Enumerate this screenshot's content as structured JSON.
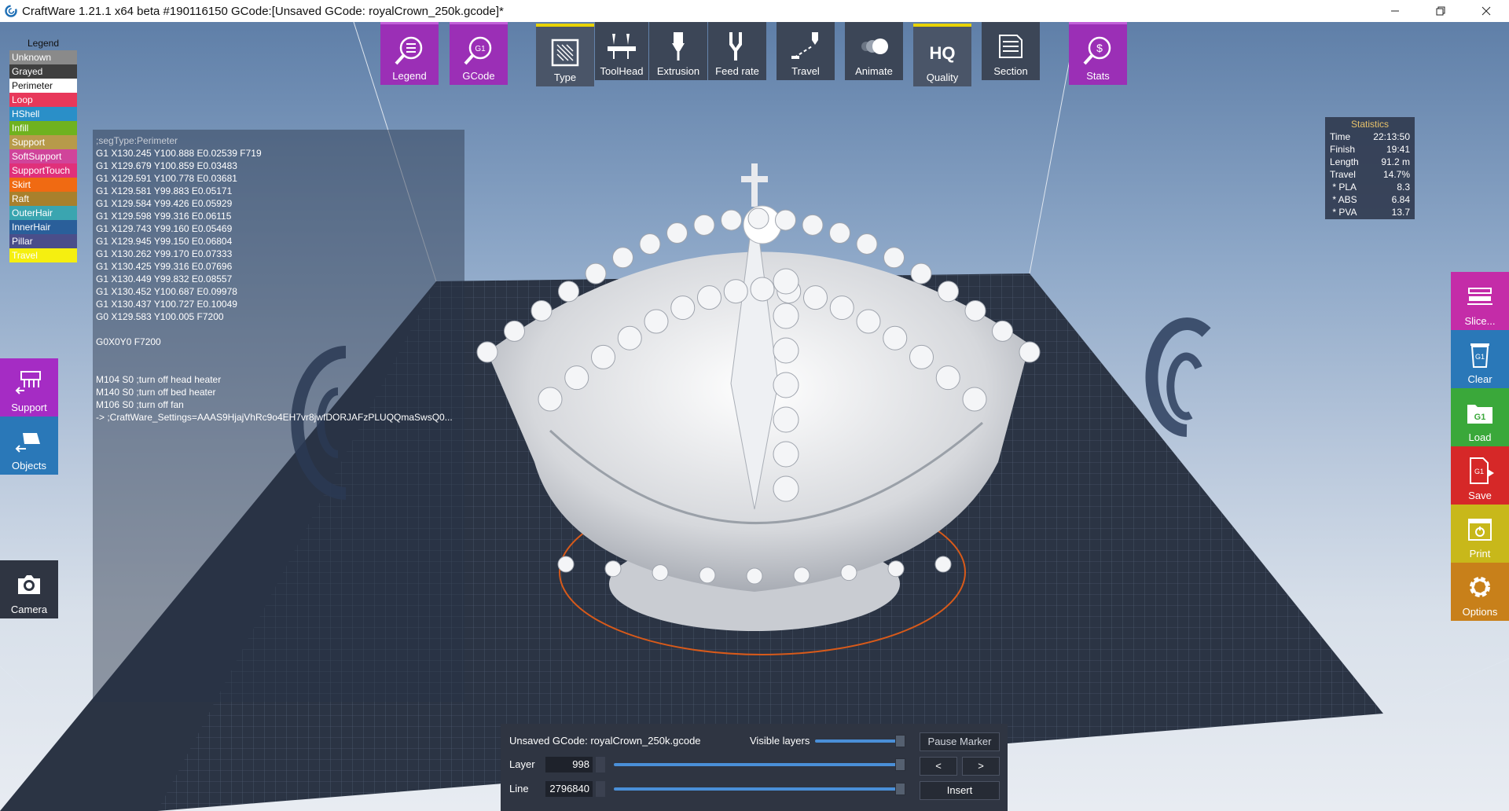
{
  "window": {
    "title": "CraftWare 1.21.1 x64 beta #190116150   GCode:[Unsaved GCode: royalCrown_250k.gcode]*"
  },
  "legend": {
    "title": "Legend",
    "items": [
      {
        "label": "Unknown",
        "color": "#8a8a8a",
        "text": "#ffffff"
      },
      {
        "label": "Grayed",
        "color": "#3f3f3f",
        "text": "#ffffff"
      },
      {
        "label": "Perimeter",
        "color": "#ffffff",
        "text": "#111111"
      },
      {
        "label": "Loop",
        "color": "#e8385a",
        "text": "#ffffff"
      },
      {
        "label": "HShell",
        "color": "#2a8fc8",
        "text": "#ffffff"
      },
      {
        "label": "Infill",
        "color": "#6fb21f",
        "text": "#ffffff"
      },
      {
        "label": "Support",
        "color": "#b79a4a",
        "text": "#ffffff"
      },
      {
        "label": "SoftSupport",
        "color": "#d0449a",
        "text": "#ffffff"
      },
      {
        "label": "SupportTouch",
        "color": "#e0307a",
        "text": "#ffffff"
      },
      {
        "label": "Skirt",
        "color": "#f06a12",
        "text": "#ffffff"
      },
      {
        "label": "Raft",
        "color": "#a8802c",
        "text": "#ffffff"
      },
      {
        "label": "OuterHair",
        "color": "#3aa5b0",
        "text": "#ffffff"
      },
      {
        "label": "InnerHair",
        "color": "#2a5f9a",
        "text": "#ffffff"
      },
      {
        "label": "Pillar",
        "color": "#4a4e8a",
        "text": "#ffffff"
      },
      {
        "label": "Travel",
        "color": "#f5ef10",
        "text": "#ffffff"
      }
    ]
  },
  "gcode": {
    "lines": [
      ";segType:Perimeter",
      "G1 X130.245 Y100.888 E0.02539 F719",
      "G1 X129.679 Y100.859 E0.03483",
      "G1 X129.591 Y100.778 E0.03681",
      "G1 X129.581 Y99.883 E0.05171",
      "G1 X129.584 Y99.426 E0.05929",
      "G1 X129.598 Y99.316 E0.06115",
      "G1 X129.743 Y99.160 E0.05469",
      "G1 X129.945 Y99.150 E0.06804",
      "G1 X130.262 Y99.170 E0.07333",
      "G1 X130.425 Y99.316 E0.07696",
      "G1 X130.449 Y99.832 E0.08557",
      "G1 X130.452 Y100.687 E0.09978",
      "G1 X130.437 Y100.727 E0.10049",
      "G0 X129.583 Y100.005 F7200",
      "",
      "G0X0Y0 F7200",
      "",
      "",
      "M104 S0 ;turn off head heater",
      "M140 S0 ;turn off bed heater",
      "M106 S0 ;turn off fan",
      "-> ;CraftWare_Settings=AAAS9HjajVhRc9o4EH7vr8jwfDORJAFzPLUQQmaSwsQ0..."
    ]
  },
  "toolbar": {
    "legend": "Legend",
    "gcode": "GCode",
    "gcode_icon_text": "G1",
    "type": "Type",
    "toolhead": "ToolHead",
    "extrusion": "Extrusion",
    "feedrate": "Feed rate",
    "travel": "Travel",
    "animate": "Animate",
    "quality": "Quality",
    "quality_icon_text": "HQ",
    "section": "Section",
    "stats": "Stats"
  },
  "left_buttons": {
    "support": "Support",
    "objects": "Objects",
    "camera": "Camera"
  },
  "right_buttons": {
    "slice": "Slice...",
    "clear": "Clear",
    "load": "Load",
    "save": "Save",
    "print": "Print",
    "options": "Options",
    "g1": "G1"
  },
  "statistics": {
    "title": "Statistics",
    "rows": [
      {
        "label": "Time",
        "value": "22:13:50"
      },
      {
        "label": "Finish",
        "value": "19:41"
      },
      {
        "label": "Length",
        "value": "91.2 m"
      },
      {
        "label": "Travel",
        "value": "14.7%"
      },
      {
        "label": " * PLA",
        "value": "8.3"
      },
      {
        "label": " * ABS",
        "value": "6.84"
      },
      {
        "label": " * PVA",
        "value": "13.7"
      }
    ]
  },
  "bottom": {
    "filename": "Unsaved GCode: royalCrown_250k.gcode",
    "visible_layers": "Visible layers",
    "layer_label": "Layer",
    "layer_value": "998",
    "line_label": "Line",
    "line_value": "2796840",
    "pause_marker": "Pause Marker",
    "prev": "<",
    "next": ">",
    "insert": "Insert"
  },
  "colors": {
    "purple": "#9b2fb6",
    "slice": "#c42ca8",
    "clear": "#2a78b8",
    "load": "#3aa83a",
    "save": "#d62828",
    "print": "#c8b81a",
    "options": "#c8801a",
    "support": "#a52cc4",
    "objects": "#2a78b8"
  }
}
